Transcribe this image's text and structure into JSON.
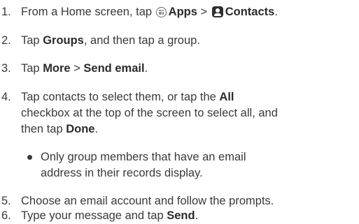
{
  "steps": [
    {
      "number": "1.",
      "segments": [
        {
          "text": "From a Home screen, tap "
        },
        {
          "icon": "apps-icon"
        },
        {
          "text": "Apps",
          "bold": true
        },
        {
          "text": " > "
        },
        {
          "icon": "contacts-icon"
        },
        {
          "text": "Contacts",
          "bold": true
        },
        {
          "text": "."
        }
      ]
    },
    {
      "number": "2.",
      "segments": [
        {
          "text": "Tap "
        },
        {
          "text": "Groups",
          "bold": true
        },
        {
          "text": ", and then tap a group."
        }
      ]
    },
    {
      "number": "3.",
      "segments": [
        {
          "text": "Tap "
        },
        {
          "text": "More",
          "bold": true
        },
        {
          "text": " > "
        },
        {
          "text": "Send email",
          "bold": true
        },
        {
          "text": "."
        }
      ]
    },
    {
      "number": "4.",
      "line1": [
        {
          "text": "Tap contacts to select them, or tap the "
        },
        {
          "text": "All",
          "bold": true
        }
      ],
      "line2": "checkbox at the top of the screen to select all, and",
      "line3": [
        {
          "text": "then tap "
        },
        {
          "text": "Done",
          "bold": true
        },
        {
          "text": "."
        }
      ]
    },
    {
      "number": "5.",
      "segments": [
        {
          "text": "Choose an email account and follow the prompts."
        }
      ]
    },
    {
      "number": "6.",
      "segments": [
        {
          "text": "Type your message and tap "
        },
        {
          "text": "Send",
          "bold": true
        },
        {
          "text": "."
        }
      ]
    }
  ],
  "note": {
    "line1": "Only group members that have an email",
    "line2": "address in their records display."
  }
}
